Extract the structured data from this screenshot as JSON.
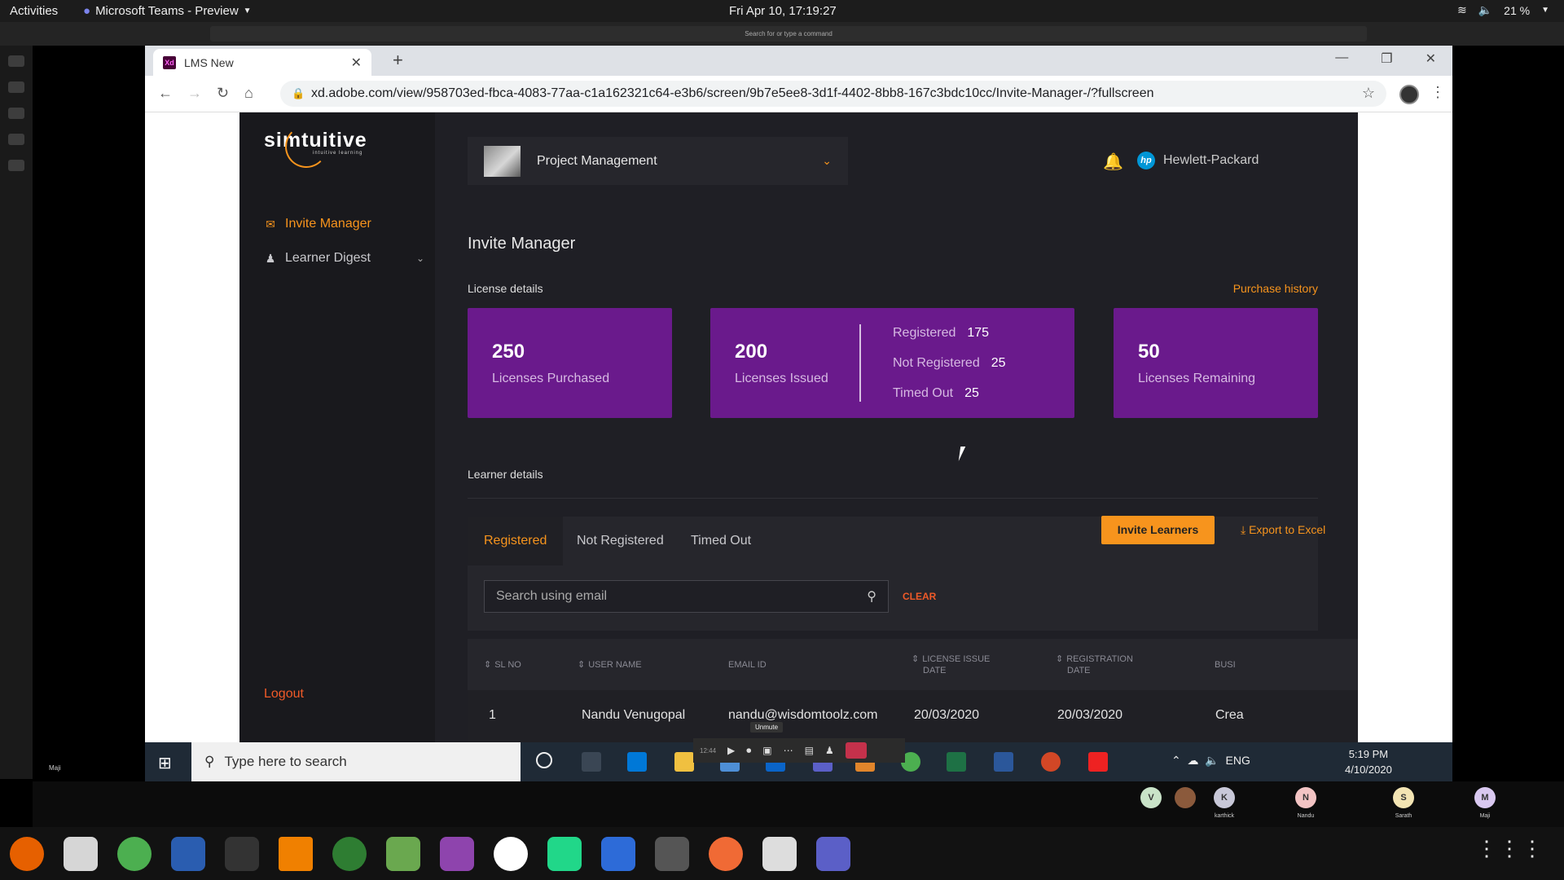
{
  "gnome": {
    "activities": "Activities",
    "app_name": "Microsoft Teams - Preview",
    "clock": "Fri Apr 10, 17:19:27",
    "battery": "21 %"
  },
  "teams": {
    "command_placeholder": "Search for or type a command"
  },
  "browser": {
    "tab_title": "LMS New",
    "url": "xd.adobe.com/view/958703ed-fbca-4083-77aa-c1a162321c64-e3b6/screen/9b7e5ee8-3d1f-4402-8bb8-167c3bdc10cc/Invite-Manager-/?fullscreen"
  },
  "app": {
    "logo": "simtuitive",
    "logo_sub": "intuitive learning",
    "sidebar": {
      "invite_manager": "Invite Manager",
      "learner_digest": "Learner Digest",
      "logout": "Logout"
    },
    "project": "Project Management",
    "company": "Hewlett-Packard",
    "page_title": "Invite Manager",
    "license_details": "License details",
    "purchase_history": "Purchase history",
    "cards": {
      "purchased": {
        "value": "250",
        "label": "Licenses Purchased"
      },
      "issued": {
        "value": "200",
        "label": "Licenses Issued"
      },
      "remaining": {
        "value": "50",
        "label": "Licenses Remaining"
      },
      "breakdown": [
        {
          "label": "Registered",
          "value": "175"
        },
        {
          "label": "Not Registered",
          "value": "25"
        },
        {
          "label": "Timed Out",
          "value": "25"
        }
      ]
    },
    "learner_details": "Learner details",
    "tabs": {
      "registered": "Registered",
      "not_registered": "Not Registered",
      "timed_out": "Timed Out"
    },
    "invite_learners": "Invite Learners",
    "export": "Export to Excel",
    "search_placeholder": "Search using email",
    "clear": "CLEAR",
    "table": {
      "headers": {
        "sl_no": "SL NO",
        "user_name": "USER NAME",
        "email": "EMAIL ID",
        "license_issue_1": "LICENSE ISSUE",
        "license_issue_2": "DATE",
        "registration_1": "REGISTRATION",
        "registration_2": "DATE",
        "business": "BUSI"
      },
      "rows": [
        {
          "sl": "1",
          "name": "Nandu Venugopal",
          "email": "nandu@wisdomtoolz.com",
          "issue_date": "20/03/2020",
          "reg_date": "20/03/2020",
          "business": "Crea"
        }
      ]
    }
  },
  "windows": {
    "search_placeholder": "Type here to search",
    "lang": "ENG",
    "time": "5:19 PM",
    "date": "4/10/2020",
    "unmute_tooltip": "Unmute",
    "meeting_time": "12:44"
  },
  "participants": [
    {
      "initial": "V",
      "name": ""
    },
    {
      "initial": "K",
      "name": "karthick"
    },
    {
      "initial": "N",
      "name": "Nandu"
    },
    {
      "initial": "S",
      "name": "Sarath"
    },
    {
      "initial": "M",
      "name": "Maji"
    }
  ],
  "self_label": "Maji"
}
